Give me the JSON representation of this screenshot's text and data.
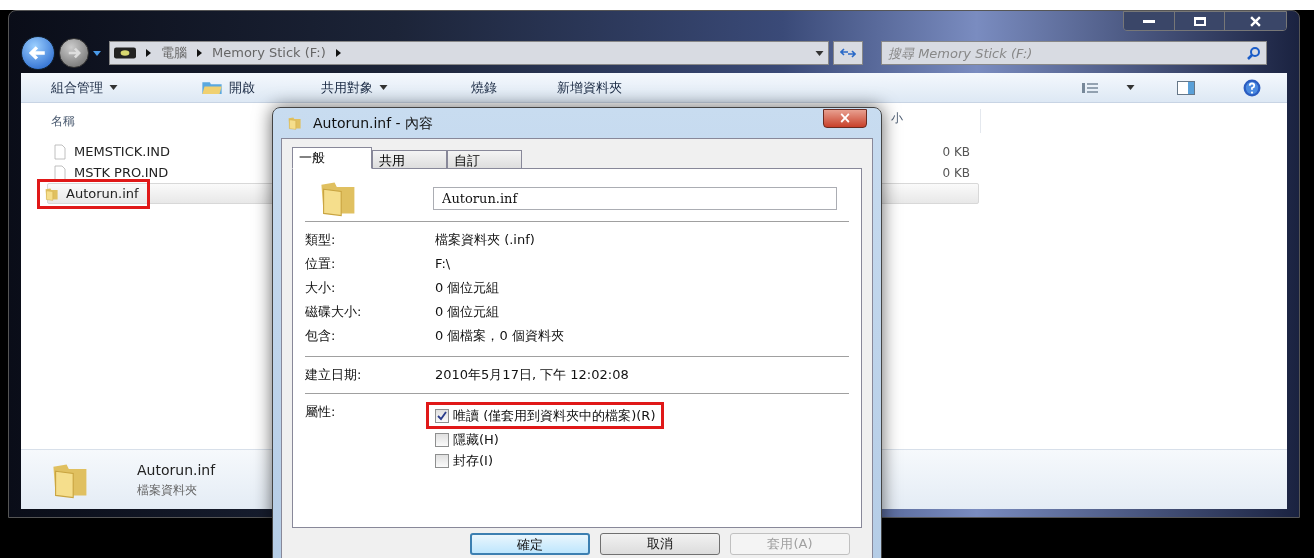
{
  "explorer": {
    "breadcrumb": [
      "電腦",
      "Memory Stick (F:)"
    ],
    "search": {
      "placeholder": "搜尋 Memory Stick (F:)"
    },
    "toolbar": [
      {
        "label": "組合管理",
        "kind": "menu"
      },
      {
        "label": "開啟",
        "kind": "icon"
      },
      {
        "label": "共用對象",
        "kind": "menu"
      },
      {
        "label": "燒錄",
        "kind": "plain"
      },
      {
        "label": "新增資料夾",
        "kind": "plain"
      }
    ],
    "columns": [
      "名稱",
      "小"
    ],
    "files": [
      {
        "name": "MEMSTICK.IND",
        "size": "0 KB",
        "kind": "file",
        "selected": false,
        "highlighted": false
      },
      {
        "name": "MSTK PRO.IND",
        "size": "0 KB",
        "kind": "file",
        "selected": false,
        "highlighted": false
      },
      {
        "name": "Autorun.inf",
        "kind": "folder",
        "selected": true,
        "highlighted": true
      }
    ],
    "details": {
      "name": "Autorun.inf",
      "type": "檔案資料夾"
    }
  },
  "dialog": {
    "title": "Autorun.inf - 內容",
    "close": "×",
    "tabs": [
      {
        "label": "一般",
        "selected": true
      },
      {
        "label": "共用",
        "selected": false
      },
      {
        "label": "自訂",
        "selected": false
      }
    ],
    "name_field": "Autorun.inf",
    "properties": [
      {
        "label": "類型:",
        "value": "檔案資料夾 (.inf)"
      },
      {
        "label": "位置:",
        "value": "F:\\"
      },
      {
        "label": "大小:",
        "value": "0 個位元組"
      },
      {
        "label": "磁碟大小:",
        "value": "0 個位元組"
      },
      {
        "label": "包含:",
        "value": "0 個檔案，0 個資料夾"
      }
    ],
    "created": {
      "label": "建立日期:",
      "value": "2010年5月17日, 下午 12:02:08"
    },
    "attributes_label": "屬性:",
    "attributes": [
      {
        "label": "唯讀 (僅套用到資料夾中的檔案)(R)",
        "checked": true,
        "highlighted": true
      },
      {
        "label": "隱藏(H)",
        "checked": false,
        "highlighted": false
      },
      {
        "label": "封存(I)",
        "checked": false,
        "highlighted": false
      }
    ],
    "buttons": [
      {
        "label": "確定",
        "default": true,
        "disabled": false
      },
      {
        "label": "取消",
        "default": false,
        "disabled": false
      },
      {
        "label": "套用(A)",
        "default": false,
        "disabled": true
      }
    ]
  }
}
